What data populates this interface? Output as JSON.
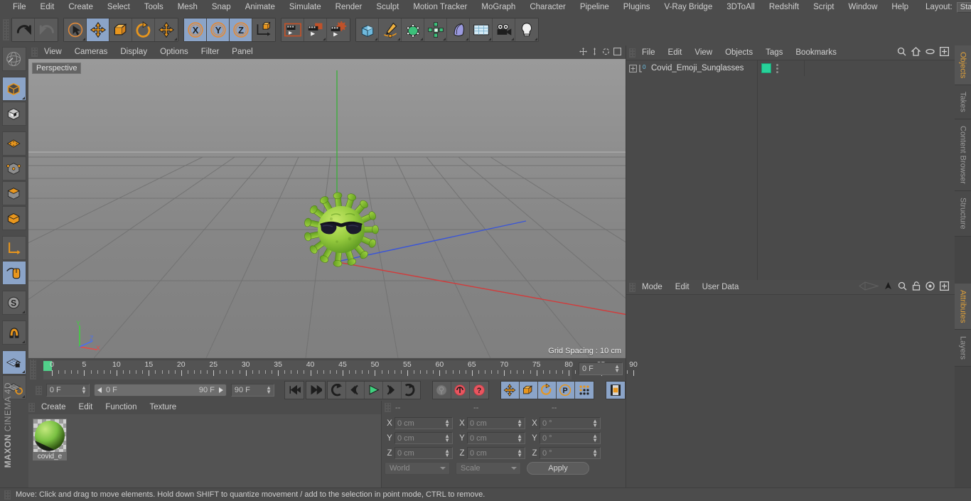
{
  "menubar": {
    "items": [
      "File",
      "Edit",
      "Create",
      "Select",
      "Tools",
      "Mesh",
      "Snap",
      "Animate",
      "Simulate",
      "Render",
      "Sculpt",
      "Motion Tracker",
      "MoGraph",
      "Character",
      "Pipeline",
      "Plugins",
      "V-Ray Bridge",
      "3DToAll",
      "Redshift",
      "Script",
      "Window",
      "Help"
    ],
    "layout_label": "Layout:",
    "layout_value": "Startup",
    "search_icon": "search-icon"
  },
  "toolbar": {
    "groups": [
      {
        "name": "undo-redo",
        "buttons": [
          {
            "icon": "undo-icon",
            "label": "Undo",
            "active": false,
            "corner": false
          },
          {
            "icon": "redo-icon",
            "label": "Redo",
            "active": false,
            "corner": false
          }
        ]
      },
      {
        "name": "transform-tools",
        "buttons": [
          {
            "icon": "live-selection-icon",
            "label": "Live Selection",
            "active": false,
            "corner": true
          },
          {
            "icon": "move-icon",
            "label": "Move",
            "active": true,
            "corner": false
          },
          {
            "icon": "scale-icon",
            "label": "Scale",
            "active": false,
            "corner": false
          },
          {
            "icon": "rotate-icon",
            "label": "Rotate",
            "active": false,
            "corner": false
          },
          {
            "icon": "move-alt-icon",
            "label": "Move Alt",
            "active": false,
            "corner": true
          }
        ]
      },
      {
        "name": "axis-locks",
        "buttons": [
          {
            "icon": "x-axis-icon",
            "label": "X Axis",
            "active": true,
            "corner": false
          },
          {
            "icon": "y-axis-icon",
            "label": "Y Axis",
            "active": true,
            "corner": false
          },
          {
            "icon": "z-axis-icon",
            "label": "Z Axis",
            "active": true,
            "corner": false
          },
          {
            "icon": "world-coordinates-icon",
            "label": "World/Object Coordinate System",
            "active": false,
            "corner": false
          }
        ]
      },
      {
        "name": "render-tools",
        "buttons": [
          {
            "icon": "render-view-icon",
            "label": "Render View",
            "active": false,
            "corner": false
          },
          {
            "icon": "render-region-icon",
            "label": "Render to Picture Viewer",
            "active": false,
            "corner": true
          },
          {
            "icon": "render-settings-icon",
            "label": "Edit Render Settings",
            "active": false,
            "corner": false
          }
        ]
      },
      {
        "name": "object-creation",
        "buttons": [
          {
            "icon": "cube-primitive-icon",
            "label": "Add Cube Object",
            "active": false,
            "corner": true
          },
          {
            "icon": "spline-pen-icon",
            "label": "Add Spline",
            "active": false,
            "corner": true
          },
          {
            "icon": "nurbs-icon",
            "label": "Add Generator Object",
            "active": false,
            "corner": true
          },
          {
            "icon": "array-icon",
            "label": "Add Modeling Object",
            "active": false,
            "corner": true
          },
          {
            "icon": "deformer-icon",
            "label": "Add Deformer Object",
            "active": false,
            "corner": true
          },
          {
            "icon": "environment-icon",
            "label": "Add Scene Object",
            "active": false,
            "corner": true
          },
          {
            "icon": "camera-icon",
            "label": "Add Camera Object",
            "active": false,
            "corner": true
          },
          {
            "icon": "light-icon",
            "label": "Add Light Object",
            "active": false,
            "corner": true
          }
        ]
      }
    ]
  },
  "leftrail": {
    "buttons": [
      {
        "icon": "make-editable-icon",
        "label": "Make Editable",
        "active": false,
        "corner": false
      },
      {
        "icon": "model-mode-icon",
        "label": "Model Mode",
        "active": true,
        "corner": true
      },
      {
        "icon": "texture-mode-icon",
        "label": "Texture Mode",
        "active": false,
        "corner": false
      },
      {
        "icon": "points-mode-icon",
        "label": "Points Mode",
        "active": false,
        "corner": false
      },
      {
        "icon": "edges-mode-icon",
        "label": "Edges Mode",
        "active": false,
        "corner": false
      },
      {
        "icon": "polygons-mode-icon",
        "label": "Polygons Mode",
        "active": false,
        "corner": false
      },
      {
        "icon": "faces-mode-icon",
        "label": "Faces Mode",
        "active": false,
        "corner": false
      },
      {
        "icon": "axis-modify-icon",
        "label": "Enable Axis Modification",
        "active": false,
        "corner": false
      },
      {
        "icon": "viewport-solo-icon",
        "label": "Enable Viewport Solo",
        "active": true,
        "corner": false
      },
      {
        "icon": "snap-icon",
        "label": "Enable Snapping",
        "active": false,
        "corner": true
      },
      {
        "icon": "magnet-icon",
        "label": "Magnet Tool",
        "active": false,
        "corner": true
      },
      {
        "icon": "workplane-lock-icon",
        "label": "Lock Workplane",
        "active": true,
        "corner": true
      },
      {
        "icon": "workplane-rotate-icon",
        "label": "Planar Workplane",
        "active": false,
        "corner": true
      }
    ],
    "brand_top": "MAXON",
    "brand_bottom": "CINEMA 4D"
  },
  "viewport": {
    "menu": [
      "View",
      "Cameras",
      "Display",
      "Options",
      "Filter",
      "Panel"
    ],
    "camera_label": "Perspective",
    "grid_spacing": "Grid Spacing : 10 cm",
    "axis_labels": {
      "x": "X",
      "y": "Y",
      "z": "Z"
    },
    "scene_object": "Covid Emoji with Sunglasses",
    "model_color": "#8ec63f"
  },
  "timeline": {
    "ticks": [
      0,
      5,
      10,
      15,
      20,
      25,
      30,
      35,
      40,
      45,
      50,
      55,
      60,
      65,
      70,
      75,
      80,
      85,
      90
    ],
    "current_frame": "0 F",
    "range_start": "0 F",
    "range_end": "90 F",
    "max_frame": "90 F",
    "frame_field_right": "0 F",
    "playhead_frame": 0,
    "transport_buttons": [
      {
        "icon": "go-to-start-icon",
        "label": "Go to Start",
        "active": false
      },
      {
        "icon": "previous-key-icon",
        "label": "Go to Previous Key",
        "active": false
      },
      {
        "icon": "previous-frame-icon",
        "label": "Go to Previous Frame",
        "active": false
      },
      {
        "icon": "play-forwards-icon",
        "label": "Play Forwards",
        "active": false
      },
      {
        "icon": "next-frame-icon",
        "label": "Go to Next Frame",
        "active": false
      },
      {
        "icon": "next-key-icon",
        "label": "Go to Next Key",
        "active": false
      },
      {
        "icon": "go-to-end-icon",
        "label": "Go to End",
        "active": false
      }
    ],
    "key_buttons": [
      {
        "icon": "record-key-icon",
        "label": "Record Active Objects",
        "active": false
      },
      {
        "icon": "autokeying-icon",
        "label": "Autokeying",
        "active": false
      },
      {
        "icon": "keyframe-selection-icon",
        "label": "Keyframe Selection",
        "active": false
      }
    ],
    "param_buttons": [
      {
        "icon": "position-key-icon",
        "label": "Position",
        "active": true
      },
      {
        "icon": "scale-key-icon",
        "label": "Scale",
        "active": true
      },
      {
        "icon": "rotation-key-icon",
        "label": "Rotation",
        "active": true
      },
      {
        "icon": "parameter-key-icon",
        "label": "Parameter (PLA)",
        "active": true
      },
      {
        "icon": "point-level-anim-icon",
        "label": "Point Level Animation",
        "active": true
      }
    ],
    "timeline_toggle": {
      "icon": "timeline-icon",
      "label": "Animation Layout Toggle",
      "active": true
    }
  },
  "materials": {
    "menu": [
      "Create",
      "Edit",
      "Function",
      "Texture"
    ],
    "items": [
      {
        "name": "covid_e",
        "full_name": "covid_emoji",
        "color": "#7ac143"
      }
    ]
  },
  "coordinates": {
    "headers": [
      "--",
      "--",
      "--"
    ],
    "rows": [
      {
        "label": "X",
        "position": "0 cm",
        "size": "0 cm",
        "rotation": "0 °"
      },
      {
        "label": "Y",
        "position": "0 cm",
        "size": "0 cm",
        "rotation": "0 °"
      },
      {
        "label": "Z",
        "position": "0 cm",
        "size": "0 cm",
        "rotation": "0 °"
      }
    ],
    "coord_system": "World",
    "mode": "Scale",
    "apply_label": "Apply"
  },
  "object_manager": {
    "menu": [
      "File",
      "Edit",
      "View",
      "Objects",
      "Tags",
      "Bookmarks"
    ],
    "icons": [
      "search-icon",
      "home-icon",
      "eye-icon",
      "expand-icon"
    ],
    "objects": [
      {
        "name": "Covid_Emoji_Sunglasses",
        "layer": "0",
        "material_color": "#27d39a",
        "expandable": true
      }
    ]
  },
  "attribute_manager": {
    "menu": [
      "Mode",
      "Edit",
      "User Data"
    ],
    "icons": [
      "preset-icon",
      "pin-icon",
      "search-icon",
      "lock-icon",
      "target-icon",
      "expand-icon"
    ]
  },
  "right_tabs_top": [
    {
      "label": "Objects",
      "active": true
    },
    {
      "label": "Takes",
      "active": false
    },
    {
      "label": "Content Browser",
      "active": false
    },
    {
      "label": "Structure",
      "active": false
    }
  ],
  "right_tabs_bottom": [
    {
      "label": "Attributes",
      "active": true
    },
    {
      "label": "Layers",
      "active": false
    }
  ],
  "statusbar": {
    "message": "Move: Click and drag to move elements. Hold down SHIFT to quantize movement / add to the selection in point mode, CTRL to remove."
  }
}
